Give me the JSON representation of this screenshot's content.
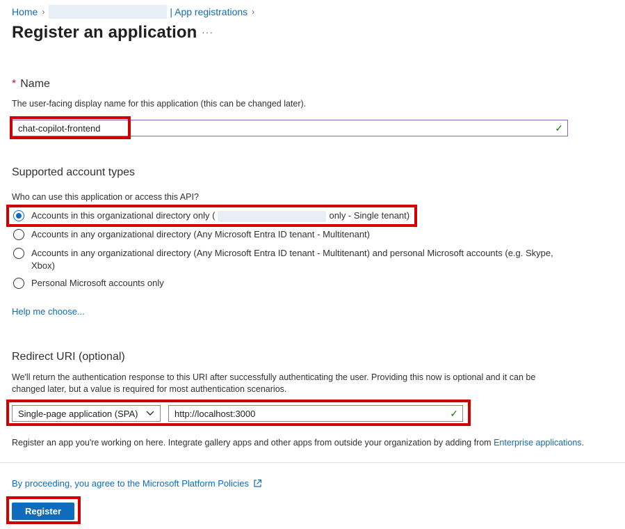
{
  "breadcrumb": {
    "home": "Home",
    "app_registrations": "| App registrations"
  },
  "page": {
    "title": "Register an application",
    "more": "···"
  },
  "name_section": {
    "required_mark": "*",
    "heading": "Name",
    "description": "The user-facing display name for this application (this can be changed later).",
    "value": "chat-copilot-frontend"
  },
  "account_types": {
    "heading": "Supported account types",
    "question": "Who can use this application or access this API?",
    "options": [
      {
        "label_prefix": "Accounts in this organizational directory only (",
        "label_suffix": "only - Single tenant)",
        "selected": true
      },
      {
        "label": "Accounts in any organizational directory (Any Microsoft Entra ID tenant - Multitenant)",
        "selected": false
      },
      {
        "label": "Accounts in any organizational directory (Any Microsoft Entra ID tenant - Multitenant) and personal Microsoft accounts (e.g. Skype, Xbox)",
        "selected": false
      },
      {
        "label": "Personal Microsoft accounts only",
        "selected": false
      }
    ],
    "help_link": "Help me choose..."
  },
  "redirect": {
    "heading": "Redirect URI (optional)",
    "description": "We'll return the authentication response to this URI after successfully authenticating the user. Providing this now is optional and it can be changed later, but a value is required for most authentication scenarios.",
    "platform": "Single-page application (SPA)",
    "uri": "http://localhost:3000"
  },
  "gallery_note": {
    "text": "Register an app you're working on here. Integrate gallery apps and other apps from outside your organization by adding from ",
    "link": "Enterprise applications",
    "end": "."
  },
  "footer": {
    "policy_link": "By proceeding, you agree to the Microsoft Platform Policies",
    "register_label": "Register"
  },
  "colors": {
    "accent": "#0f6cbd",
    "highlight": "#d10000",
    "valid": "#107c10"
  }
}
